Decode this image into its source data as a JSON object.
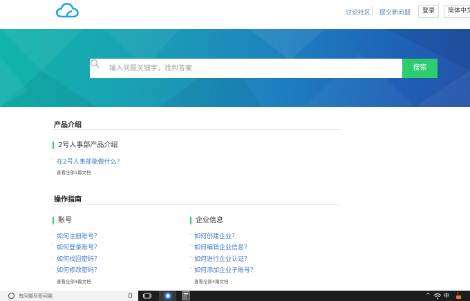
{
  "header": {
    "logo": "cloud-logo",
    "links": {
      "community": "讨论社区",
      "submit_question": "提交新问题"
    },
    "login_label": "登录",
    "language_label": "简体中文"
  },
  "search": {
    "placeholder": "输入问题关键字，找到答案",
    "button_label": "搜索"
  },
  "sections": {
    "product_intro": {
      "title": "产品介绍",
      "groups": [
        {
          "title": "2号人事部产品介绍",
          "links": [
            "在2号人事部能做什么？"
          ],
          "view_all": "查看全部1篇文档"
        }
      ]
    },
    "guide": {
      "title": "操作指南",
      "groups": [
        {
          "title": "账号",
          "links": [
            "如何注册账号？",
            "如何登录账号？",
            "如何找回密码？",
            "如何修改密码？"
          ],
          "view_all": "查看全部4篇文档"
        },
        {
          "title": "企业信息",
          "links": [
            "如何创建企业？",
            "如何编辑企业信息？",
            "如何进行企业认证？",
            "如何添加企业子账号？"
          ],
          "view_all": "查看全部4篇文档"
        }
      ]
    }
  },
  "taskbar": {
    "search_placeholder": "有问题尽管问我",
    "tray_text": "^ 中"
  },
  "colors": {
    "accent_green": "#2ecc71",
    "link_blue": "#3e7dc2",
    "logo_blue": "#1fa0e6"
  }
}
